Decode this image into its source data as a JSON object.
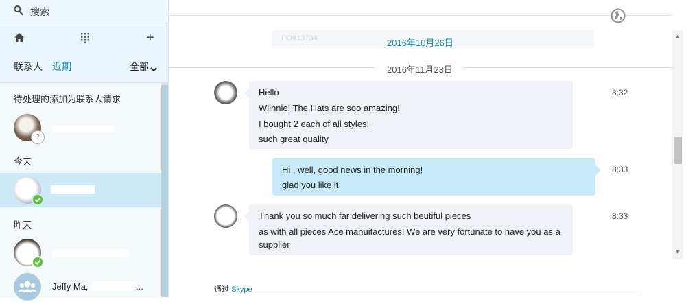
{
  "search": {
    "placeholder": "搜索",
    "icon": "search-icon"
  },
  "toolbar": {
    "home_icon": "home-icon",
    "dialpad_icon": "dialpad-icon",
    "add_label": "+"
  },
  "tabs": {
    "contacts": "联系人",
    "recent": "近期",
    "all": "全部",
    "active_color": "#1a8ab8"
  },
  "sections": {
    "pending": "待处理的添加为联系人请求",
    "today": "今天",
    "yesterday": "昨天"
  },
  "contacts": [
    {
      "name": "",
      "status": "unknown",
      "status_glyph": "?"
    },
    {
      "name": "",
      "status": "online",
      "selected": true
    },
    {
      "name": "",
      "status": "online"
    },
    {
      "name": "Jeffy Ma,",
      "suffix": "...",
      "status": "group"
    }
  ],
  "chat": {
    "faded_text": "PO#13734",
    "date1": "2016年10月26日",
    "date2": "2016年11月23日",
    "messages": [
      {
        "direction": "in",
        "lines": [
          "Hello",
          "Wiinnie! The      Hats are soo amazing!",
          "I bought 2 each of all styles!",
          "such great quality"
        ],
        "time": "8:32"
      },
      {
        "direction": "out",
        "lines": [
          "Hi      , well, good news in the morning!",
          "glad you like it"
        ],
        "time": "8:33"
      },
      {
        "direction": "in",
        "lines": [
          "Thank you so much far delivering such beutiful pieces",
          "as with all pieces Ace manuifactures! We are very fortunate to have you as a",
          "supplier"
        ],
        "time": "8:33"
      }
    ],
    "via_prefix": "通过",
    "via_link": "Skype"
  },
  "colors": {
    "accent": "#1a8ab8",
    "bubble_in": "#eef2f6",
    "bubble_out": "#c7e9f9",
    "online": "#5fbf3d"
  }
}
